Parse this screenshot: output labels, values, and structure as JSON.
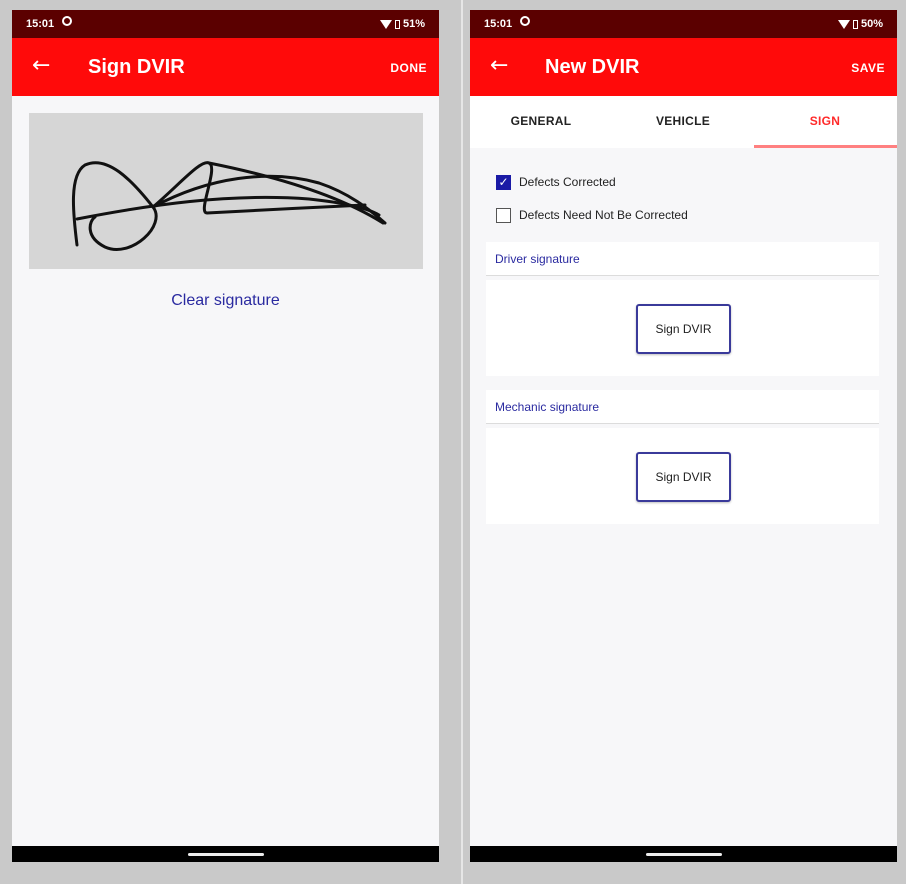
{
  "left": {
    "status": {
      "time": "15:01",
      "battery": "51%"
    },
    "title": "Sign DVIR",
    "action": "DONE",
    "clear_label": "Clear signature"
  },
  "right": {
    "status": {
      "time": "15:01",
      "battery": "50%"
    },
    "title": "New DVIR",
    "action": "SAVE",
    "tabs": [
      {
        "label": "GENERAL",
        "active": false
      },
      {
        "label": "VEHICLE",
        "active": false
      },
      {
        "label": "SIGN",
        "active": true
      }
    ],
    "checkboxes": [
      {
        "label": "Defects Corrected",
        "checked": true
      },
      {
        "label": "Defects Need Not Be Corrected",
        "checked": false
      }
    ],
    "sections": [
      {
        "title": "Driver signature",
        "button": "Sign DVIR"
      },
      {
        "title": "Mechanic signature",
        "button": "Sign DVIR"
      }
    ]
  },
  "colors": {
    "app_bar": "#ff0a0a",
    "status_bar": "#5b0000",
    "accent_link": "#2a2aa0",
    "active_tab": "#ff2a2a"
  },
  "icons": [
    "back-arrow-icon",
    "wifi-icon",
    "battery-icon",
    "sync-icon",
    "checkmark-icon"
  ]
}
